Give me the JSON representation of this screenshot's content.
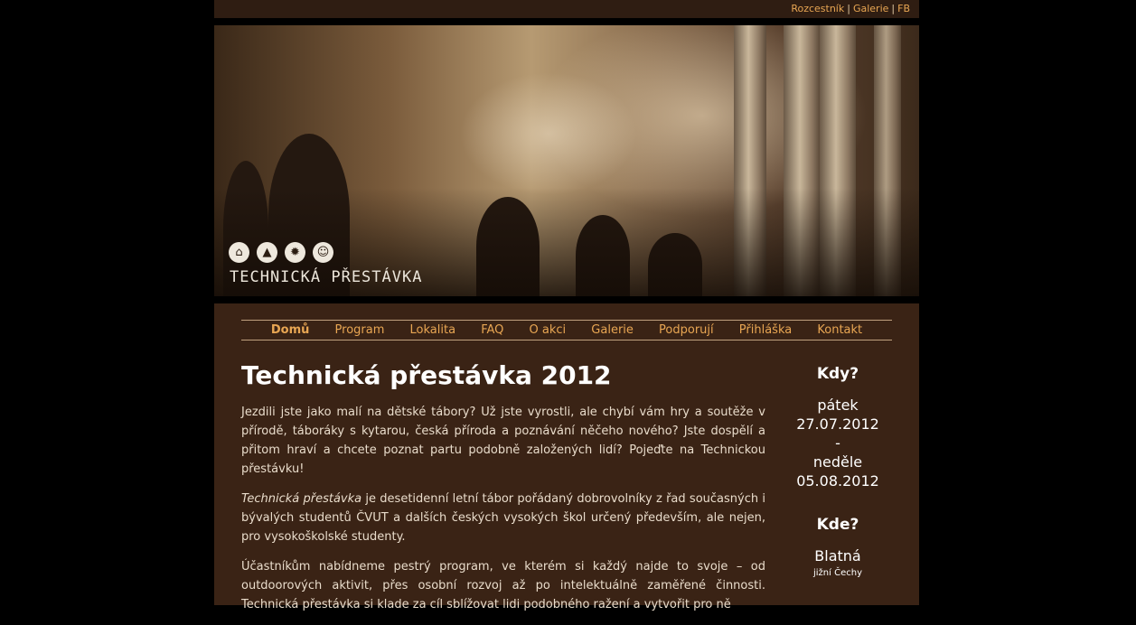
{
  "topbar": {
    "links": [
      "Rozcestník",
      "Galerie",
      "FB"
    ],
    "separator": "|"
  },
  "banner": {
    "logo_text": "TECHNICKÁ PŘESTÁVKA",
    "icons": [
      "tent-icon",
      "tree-icon",
      "sun-icon",
      "people-icon"
    ]
  },
  "nav": {
    "items": [
      "Domů",
      "Program",
      "Lokalita",
      "FAQ",
      "O akci",
      "Galerie",
      "Podporují",
      "Přihláška",
      "Kontakt"
    ],
    "active": "Domů"
  },
  "main": {
    "title": "Technická přestávka 2012",
    "p1": "Jezdili jste jako malí na dětské tábory? Už jste vyrostli, ale chybí vám hry a soutěže v přírodě, táboráky s kytarou, česká příroda a poznávání něčeho nového? Jste dospělí a přitom hraví a chcete poznat partu podobně založených lidí? Pojeďte na Technickou přestávku!",
    "p2_em": "Technická přestávka",
    "p2_rest": " je desetidenní letní tábor pořádaný dobrovolníky z řad současných i bývalých studentů ČVUT a dalších českých vysokých škol určený především, ale nejen, pro vysokoškolské studenty.",
    "p3": "Účastníkům nabídneme pestrý program, ve kterém si každý najde to svoje – od outdoorových aktivit, přes osobní rozvoj až po intelektuálně zaměřené činnosti. Technická přestávka si klade za cíl sblížovat lidi podobného ražení a vytvořit pro ně"
  },
  "side": {
    "when_title": "Kdy?",
    "start_day": "pátek",
    "start_date": "27.07.2012",
    "dash": "-",
    "end_day": "neděle",
    "end_date": "05.08.2012",
    "where_title": "Kde?",
    "place": "Blatná",
    "region": "jižní Čechy"
  },
  "colors": {
    "background": "#000000",
    "panel": "#3a2315",
    "topbar": "#2f1d12",
    "link": "#e8a653"
  }
}
